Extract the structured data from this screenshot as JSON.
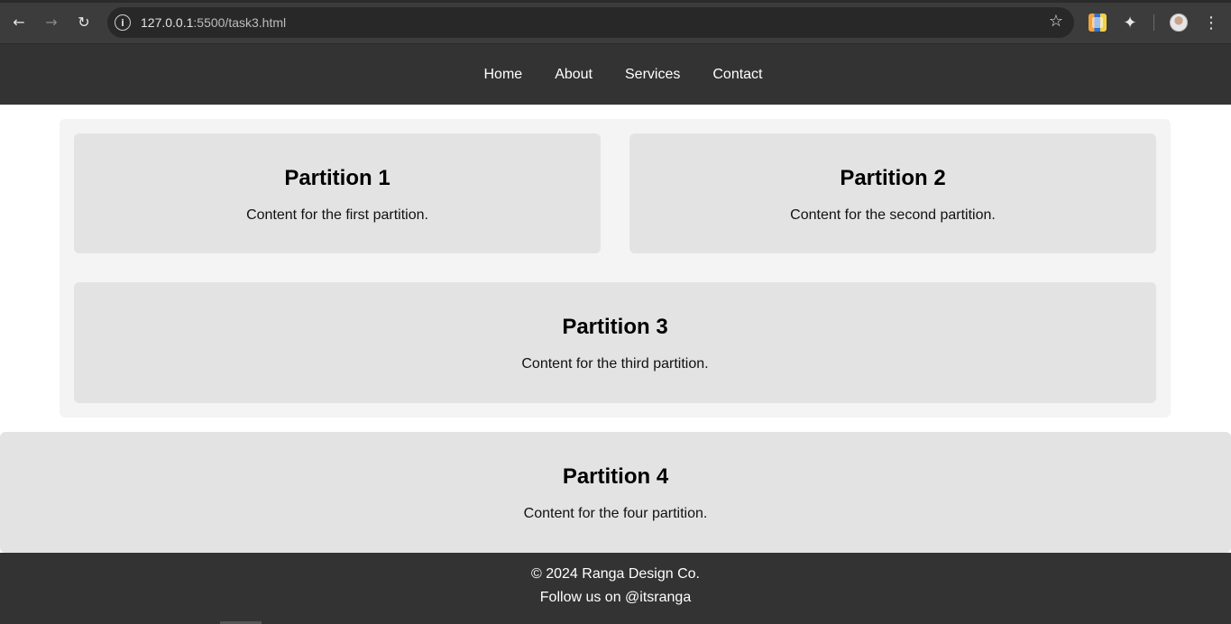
{
  "browser": {
    "url_host": "127.0.0.1",
    "url_rest": ":5500/task3.html",
    "icons": {
      "back": "back-arrow-icon",
      "forward": "forward-arrow-icon",
      "reload": "reload-icon",
      "info": "info-icon",
      "bookmark": "star-icon",
      "extension": "extension-icon",
      "extensions_menu": "puzzle-icon",
      "profile": "avatar",
      "menu": "kebab-menu-icon"
    }
  },
  "header": {
    "nav": [
      "Home",
      "About",
      "Services",
      "Contact"
    ]
  },
  "partitions": [
    {
      "title": "Partition 1",
      "text": "Content for the first partition."
    },
    {
      "title": "Partition 2",
      "text": "Content for the second partition."
    },
    {
      "title": "Partition 3",
      "text": "Content for the third partition."
    },
    {
      "title": "Partition 4",
      "text": "Content for the four partition."
    }
  ],
  "footer": {
    "copyright": "© 2024 Ranga Design Co.",
    "follow": "Follow us on @itsranga"
  },
  "colors": {
    "header_bg": "#333333",
    "container_bg": "#f4f4f4",
    "partition_bg": "#e3e3e3",
    "footer_bg": "#333333"
  }
}
